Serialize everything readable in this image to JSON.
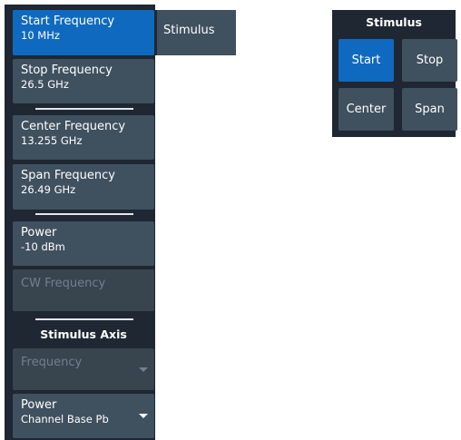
{
  "softkeys": {
    "start": {
      "label": "Start Frequency",
      "value": "10 MHz"
    },
    "stop": {
      "label": "Stop Frequency",
      "value": "26.5 GHz"
    },
    "center": {
      "label": "Center Frequency",
      "value": "13.255 GHz"
    },
    "span": {
      "label": "Span Frequency",
      "value": "26.49 GHz"
    },
    "power": {
      "label": "Power",
      "value": "-10 dBm"
    },
    "cw": {
      "label": "CW Frequency"
    },
    "axis_heading": "Stimulus Axis",
    "axis_frequency": {
      "label": "Frequency"
    },
    "axis_power": {
      "label": "Power",
      "value": "Channel Base Pb"
    }
  },
  "tab": {
    "label": "Stimulus"
  },
  "stimulus_box": {
    "title": "Stimulus",
    "buttons": [
      "Start",
      "Stop",
      "Center",
      "Span"
    ]
  },
  "colors": {
    "panel_bg": "#1e2732",
    "button_bg": "#3f505f",
    "active": "#0f6abf",
    "disabled_text": "#71808c"
  }
}
